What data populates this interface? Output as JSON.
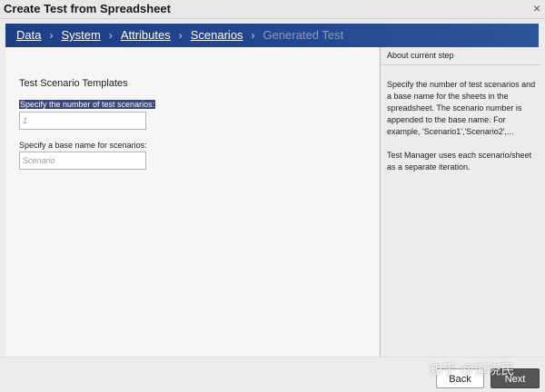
{
  "window": {
    "title": "Create Test from Spreadsheet",
    "close_glyph": "×"
  },
  "breadcrumb": {
    "items": [
      {
        "label": "Data",
        "state": "link"
      },
      {
        "label": "System",
        "state": "link"
      },
      {
        "label": "Attributes",
        "state": "link"
      },
      {
        "label": "Scenarios",
        "state": "link"
      },
      {
        "label": "Generated Test",
        "state": "disabled"
      }
    ],
    "separator": "›"
  },
  "form": {
    "section_title": "Test Scenario Templates",
    "count_label": "Specify the number of test scenarios:",
    "count_placeholder": "1",
    "basename_label": "Specify a base name for scenarios:",
    "basename_placeholder": "Scenario"
  },
  "side_panel": {
    "title": "About current step",
    "paragraph1": "Specify the number of test scenarios and a base name for the sheets in the spreadsheet. The scenario number is appended to the base name. For example, 'Scenario1','Scenario2',...",
    "paragraph2": "Test Manager uses each scenario/sheet as a separate iteration."
  },
  "footer": {
    "back_label": "Back",
    "next_label": "Next",
    "watermark": "知乎 @道晓民"
  },
  "colors": {
    "crumb_bar": "#23488f",
    "highlight": "#3a4677",
    "next_button": "#555555"
  }
}
